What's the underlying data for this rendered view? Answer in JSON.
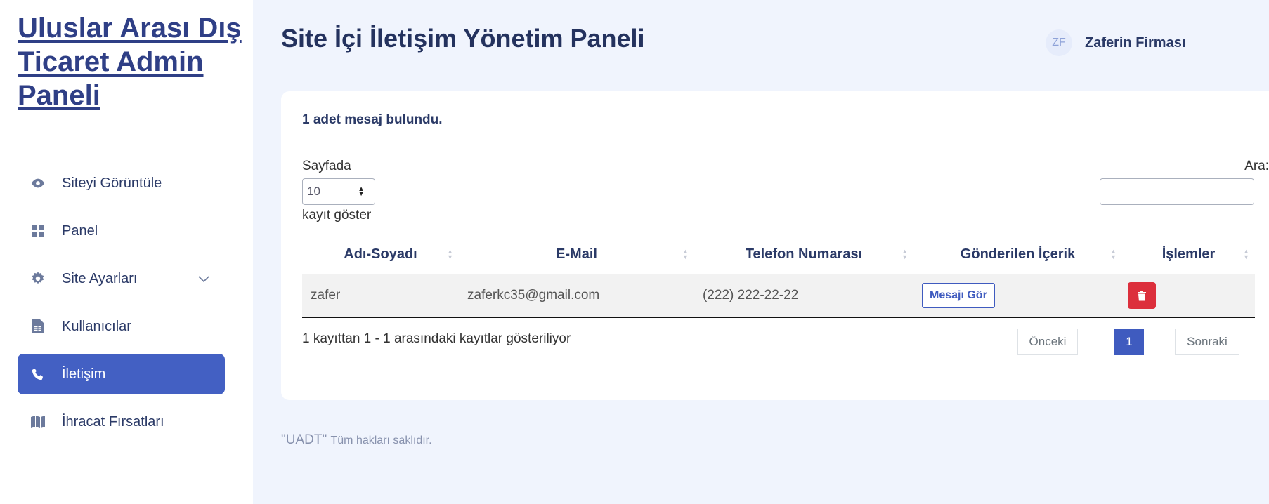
{
  "brand": {
    "title": "Uluslar Arası Dış Ticaret Admin Paneli"
  },
  "sidebar": {
    "items": [
      {
        "label": "Siteyi Görüntüle",
        "icon": "eye-icon"
      },
      {
        "label": "Panel",
        "icon": "grid-icon"
      },
      {
        "label": "Site Ayarları",
        "icon": "gear-icon"
      },
      {
        "label": "Kullanıcılar",
        "icon": "file-table-icon"
      },
      {
        "label": "İletişim",
        "icon": "phone-icon",
        "active": true
      },
      {
        "label": "İhracat Fırsatları",
        "icon": "map-icon"
      }
    ]
  },
  "header": {
    "title": "Site İçi İletişim Yönetim Paneli",
    "user_initials": "ZF",
    "user_name": "Zaferin Firması"
  },
  "main": {
    "count_text": "1 adet mesaj bulundu.",
    "length_label_top": "Sayfada",
    "length_value": "10",
    "length_label_bottom": "kayıt göster",
    "search_label": "Ara:",
    "search_value": "",
    "columns": [
      "Adı-Soyadı",
      "E-Mail",
      "Telefon Numarası",
      "Gönderilen İçerik",
      "İşlemler"
    ],
    "rows": [
      {
        "name": "zafer",
        "email": "zaferkc35@gmail.com",
        "phone": "(222) 222-22-22",
        "action_label": "Mesajı Gör"
      }
    ],
    "info_text": "1 kayıttan 1 - 1 arasındaki kayıtlar gösteriliyor",
    "pagination": {
      "prev": "Önceki",
      "current": "1",
      "next": "Sonraki"
    }
  },
  "footer": {
    "brand": "\"UADT\"",
    "text": "Tüm hakları saklıdır."
  },
  "colors": {
    "accent": "#4360c3",
    "danger": "#dc2f3c",
    "background": "#f0f4fd"
  }
}
